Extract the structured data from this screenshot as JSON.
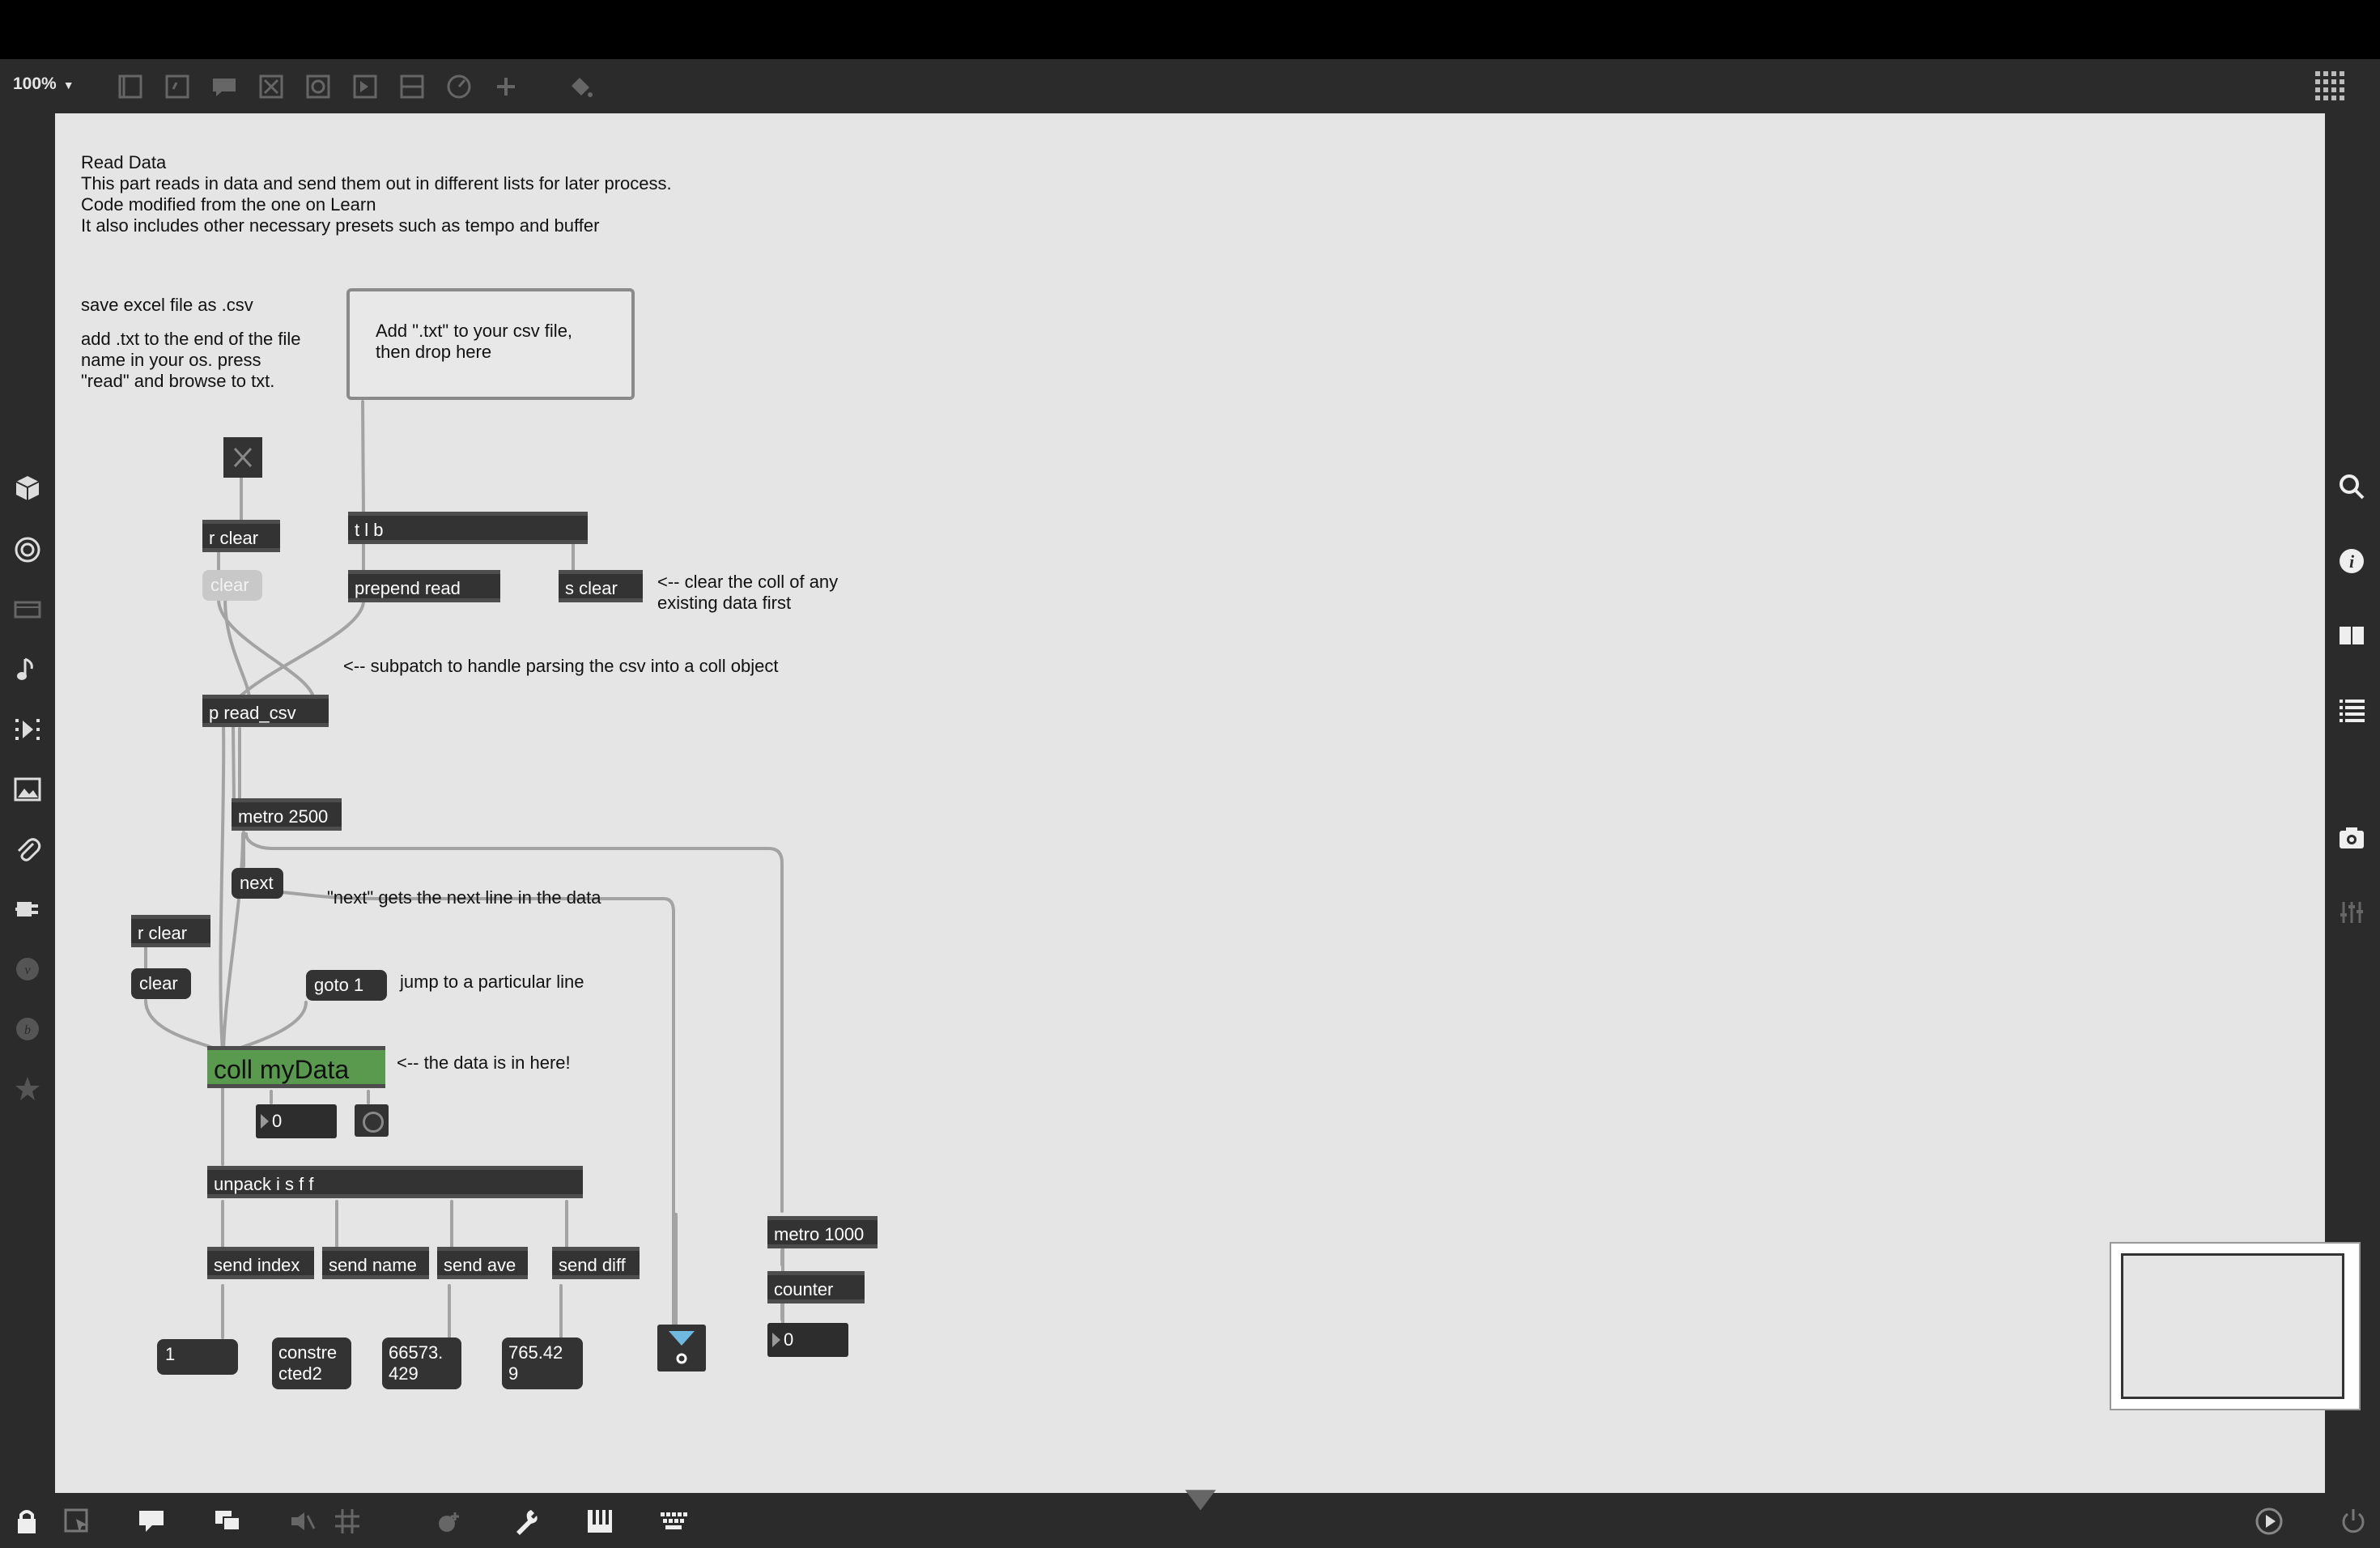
{
  "toolbar": {
    "zoom": "100%"
  },
  "comments": {
    "read_data": "Read Data\nThis part reads in data and send them out in different lists for later process.\nCode modified from the one on Learn\nIt also includes other necessary presets such as tempo and buffer",
    "save_excel": "save excel file as .csv",
    "add_txt": "add .txt to the end of the file\nname in your os. press\n\"read\" and browse to txt.",
    "clear_coll": "<-- clear the coll of any\nexisting data first",
    "subpatch": "<-- subpatch to handle parsing the csv into a coll object",
    "next_line": "\"next\" gets the next line in the data",
    "jump": "jump to a particular line",
    "data_here": "<-- the data is in here!"
  },
  "dropbox": {
    "label": "Add \".txt\" to your csv file,\nthen drop here"
  },
  "objects": {
    "r_clear_1": "r clear",
    "tlb": "t l b",
    "prepend_read": "prepend read",
    "s_clear": "s clear",
    "p_read_csv": "p read_csv",
    "metro_2500": "metro 2500",
    "r_clear_2": "r clear",
    "coll": "coll myData",
    "unpack": "unpack i s f f",
    "send_index": "send index",
    "send_name": "send name",
    "send_ave": "send ave",
    "send_diff": "send diff",
    "metro_1000": "metro 1000",
    "counter": "counter"
  },
  "messages": {
    "clear_1": "clear",
    "next": "next",
    "clear_2": "clear",
    "goto": "goto 1",
    "out_index": "1",
    "out_name": "constre\ncted2",
    "out_ave": "66573.\n429",
    "out_diff": "765.42\n9"
  },
  "numbers": {
    "coll_num": "0",
    "counter_num": "0"
  },
  "colors": {
    "coll": "#5a9a4f",
    "canvas": "#e5e5e5",
    "chrome": "#2b2b2b"
  }
}
